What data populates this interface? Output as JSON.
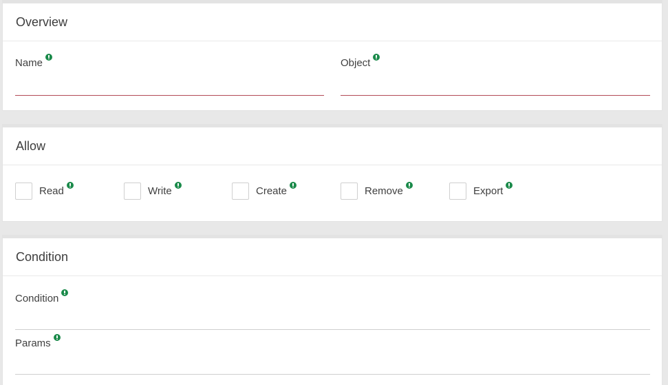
{
  "overview": {
    "title": "Overview",
    "name_label": "Name",
    "name_value": "",
    "object_label": "Object",
    "object_value": ""
  },
  "allow": {
    "title": "Allow",
    "items": [
      {
        "label": "Read",
        "checked": false
      },
      {
        "label": "Write",
        "checked": false
      },
      {
        "label": "Create",
        "checked": false
      },
      {
        "label": "Remove",
        "checked": false
      },
      {
        "label": "Export",
        "checked": false
      }
    ]
  },
  "condition": {
    "title": "Condition",
    "condition_label": "Condition",
    "condition_value": "",
    "params_label": "Params",
    "params_value": ""
  },
  "colors": {
    "info_icon": "#1a8a4a",
    "required_underline": "#b24a55"
  },
  "icons": {
    "info": "info-icon"
  }
}
